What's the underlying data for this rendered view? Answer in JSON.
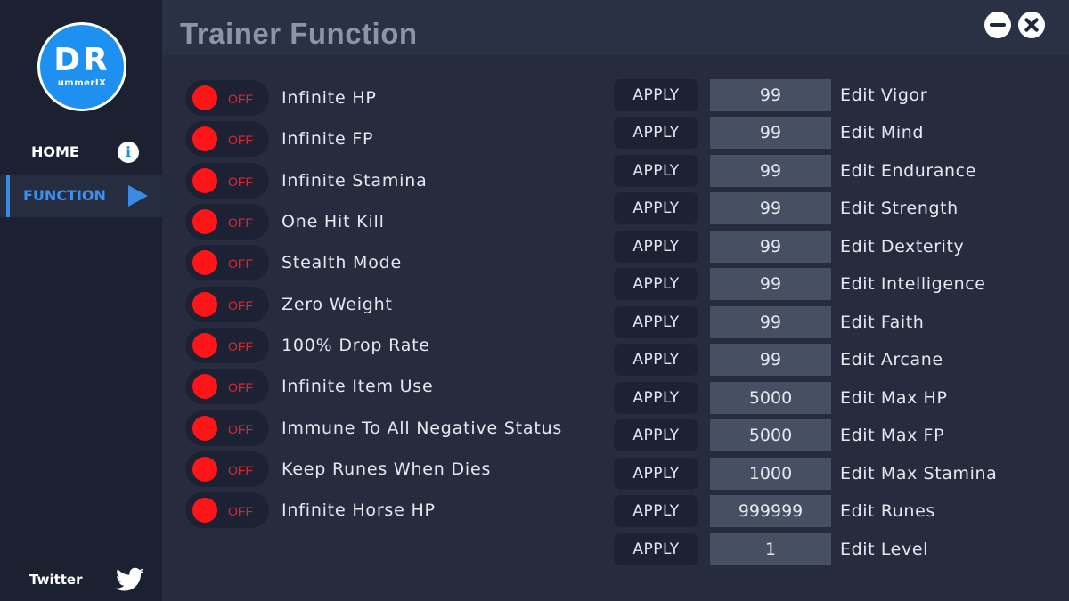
{
  "brand": {
    "logo_main": "DR",
    "logo_sub": "ummerIX"
  },
  "sidebar": {
    "items": [
      {
        "label": "HOME",
        "icon": "info-icon",
        "active": false
      },
      {
        "label": "FUNCTION",
        "icon": "play-icon",
        "active": true
      }
    ],
    "footer": {
      "label": "Twitter",
      "icon": "twitter-icon"
    }
  },
  "header": {
    "title": "Trainer Function"
  },
  "colors": {
    "background": "#262b3e",
    "sidebar": "#1b2131",
    "accent": "#3b8ae6",
    "toggle_off": "#ff1418",
    "value_box": "#465062"
  },
  "toggles": [
    {
      "label": "Infinite HP",
      "state": "OFF"
    },
    {
      "label": "Infinite FP",
      "state": "OFF"
    },
    {
      "label": "Infinite Stamina",
      "state": "OFF"
    },
    {
      "label": "One Hit Kill",
      "state": "OFF"
    },
    {
      "label": "Stealth Mode",
      "state": "OFF"
    },
    {
      "label": "Zero Weight",
      "state": "OFF"
    },
    {
      "label": "100% Drop Rate",
      "state": "OFF"
    },
    {
      "label": "Infinite Item Use",
      "state": "OFF"
    },
    {
      "label": "Immune To All Negative Status",
      "state": "OFF"
    },
    {
      "label": "Keep Runes When Dies",
      "state": "OFF"
    },
    {
      "label": "Infinite Horse HP",
      "state": "OFF"
    }
  ],
  "stats": [
    {
      "apply_label": "APPLY",
      "value": "99",
      "label": "Edit Vigor"
    },
    {
      "apply_label": "APPLY",
      "value": "99",
      "label": "Edit Mind"
    },
    {
      "apply_label": "APPLY",
      "value": "99",
      "label": "Edit Endurance"
    },
    {
      "apply_label": "APPLY",
      "value": "99",
      "label": "Edit Strength"
    },
    {
      "apply_label": "APPLY",
      "value": "99",
      "label": "Edit Dexterity"
    },
    {
      "apply_label": "APPLY",
      "value": "99",
      "label": "Edit Intelligence"
    },
    {
      "apply_label": "APPLY",
      "value": "99",
      "label": "Edit Faith"
    },
    {
      "apply_label": "APPLY",
      "value": "99",
      "label": "Edit Arcane"
    },
    {
      "apply_label": "APPLY",
      "value": "5000",
      "label": "Edit Max HP"
    },
    {
      "apply_label": "APPLY",
      "value": "5000",
      "label": "Edit Max FP"
    },
    {
      "apply_label": "APPLY",
      "value": "1000",
      "label": "Edit Max Stamina"
    },
    {
      "apply_label": "APPLY",
      "value": "999999",
      "label": "Edit Runes"
    },
    {
      "apply_label": "APPLY",
      "value": "1",
      "label": "Edit Level"
    }
  ]
}
